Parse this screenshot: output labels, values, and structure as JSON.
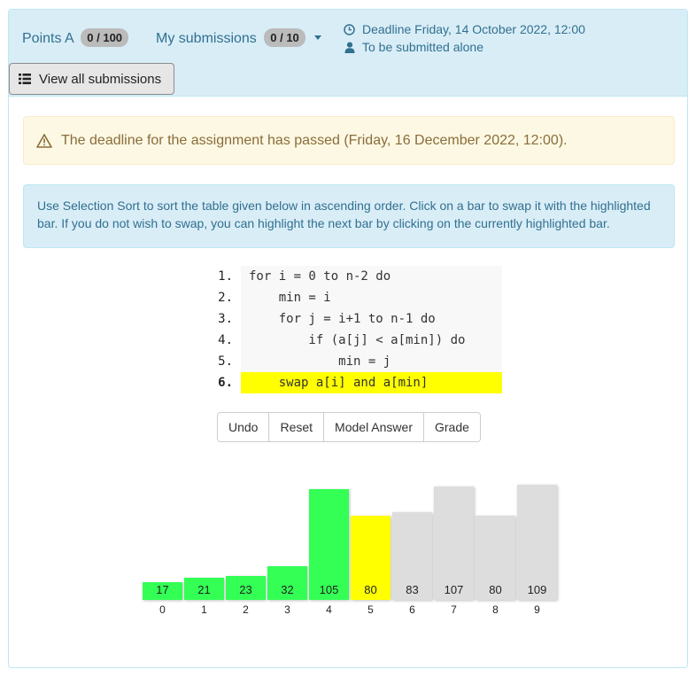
{
  "header": {
    "points_label": "Points A",
    "points_badge": "0 / 100",
    "submissions_label": "My submissions",
    "submissions_badge": "0 / 10",
    "deadline_text": "Deadline Friday, 14 October 2022, 12:00",
    "submit_mode_text": "To be submitted alone",
    "view_all_label": "View all submissions"
  },
  "alerts": {
    "deadline_passed": "The deadline for the assignment has passed (Friday, 16 December 2022, 12:00).",
    "instructions": "Use Selection Sort to sort the table given below in ascending order. Click on a bar to swap it with the highlighted bar. If you do not wish to swap, you can highlight the next bar by clicking on the currently highlighted bar."
  },
  "code": {
    "lines": [
      {
        "num": "1.",
        "text": "for i = 0 to n-2 do",
        "highlight": false
      },
      {
        "num": "2.",
        "text": "    min = i",
        "highlight": false
      },
      {
        "num": "3.",
        "text": "    for j = i+1 to n-1 do",
        "highlight": false
      },
      {
        "num": "4.",
        "text": "        if (a[j] < a[min]) do",
        "highlight": false
      },
      {
        "num": "5.",
        "text": "            min = j",
        "highlight": false
      },
      {
        "num": "6.",
        "text": "    swap a[i] and a[min]",
        "highlight": true
      }
    ]
  },
  "buttons": {
    "undo": "Undo",
    "reset": "Reset",
    "model_answer": "Model Answer",
    "grade": "Grade"
  },
  "array": {
    "values": [
      17,
      21,
      23,
      32,
      105,
      80,
      83,
      107,
      80,
      109
    ],
    "indices": [
      "0",
      "1",
      "2",
      "3",
      "4",
      "5",
      "6",
      "7",
      "8",
      "9"
    ],
    "states": [
      "sorted",
      "sorted",
      "sorted",
      "sorted",
      "sorted",
      "highlighted",
      "unsorted",
      "unsorted",
      "unsorted",
      "unsorted"
    ]
  },
  "colors": {
    "sorted": "#33ff55",
    "highlighted": "#ffff00",
    "unsorted": "#dddddd",
    "header_bg": "#d9edf7",
    "link": "#31708f"
  }
}
